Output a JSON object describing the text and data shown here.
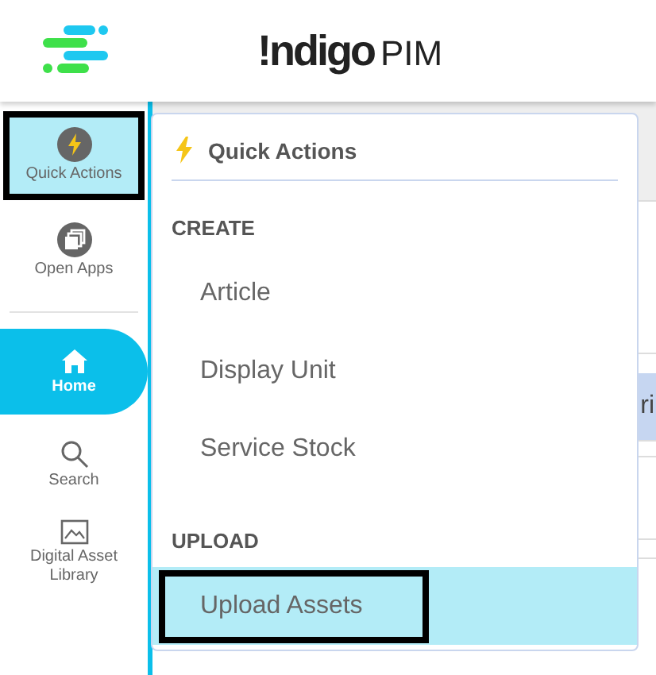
{
  "header": {
    "logo_brand": "!ndigo",
    "logo_product": "PIM"
  },
  "sidebar": {
    "top_items": [
      {
        "label": "Quick Actions",
        "kind": "bolt",
        "open": true,
        "highlighted": true
      },
      {
        "label": "Open Apps",
        "kind": "apps",
        "open": false,
        "highlighted": false
      }
    ],
    "items": [
      {
        "label": "Home",
        "kind": "home",
        "selected": true
      },
      {
        "label": "Search",
        "kind": "search",
        "selected": false
      },
      {
        "label": "Digital Asset Library",
        "kind": "image",
        "selected": false
      }
    ]
  },
  "background": {
    "row_text": "ri"
  },
  "quick_actions": {
    "title": "Quick Actions",
    "sections": [
      {
        "heading": "CREATE",
        "items": [
          {
            "label": "Article",
            "selected": false,
            "highlighted": false
          },
          {
            "label": "Display Unit",
            "selected": false,
            "highlighted": false
          },
          {
            "label": "Service Stock",
            "selected": false,
            "highlighted": false
          }
        ]
      },
      {
        "heading": "UPLOAD",
        "items": [
          {
            "label": "Upload Assets",
            "selected": true,
            "highlighted": true
          }
        ]
      }
    ]
  }
}
